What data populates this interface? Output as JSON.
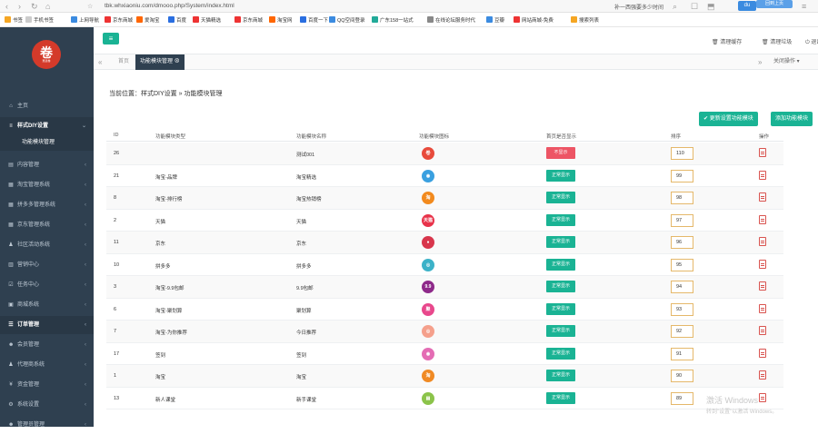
{
  "browser": {
    "url": "tbk.whxiaoniu.com/dmooo.php/System/index.html",
    "search": "补一西强要多少时间",
    "extra": "回到上页"
  },
  "bookmarks": [
    "书签",
    "手机书签",
    "上网导航",
    "京东商城",
    "爱淘宝",
    "百度",
    "天猫精选",
    "京东商城",
    "淘宝网",
    "百度一下",
    "QQ空间登录",
    "广东158一站式",
    "在线论坛服务时代",
    "豆瓣",
    "网站商城-免费",
    "搜索列表"
  ],
  "sidebar": {
    "logo": "卷",
    "logo_sub": "惠选卷",
    "items": [
      {
        "label": "主页"
      },
      {
        "label": "样式DIY设置"
      },
      {
        "label": "功能模块管理"
      },
      {
        "label": "内容管理"
      },
      {
        "label": "淘宝管理系统"
      },
      {
        "label": "拼多多管理系统"
      },
      {
        "label": "京东管理系统"
      },
      {
        "label": "社区活动系统"
      },
      {
        "label": "营销中心"
      },
      {
        "label": "任务中心"
      },
      {
        "label": "商城系统"
      },
      {
        "label": "订单管理"
      },
      {
        "label": "会员管理"
      },
      {
        "label": "代理商系统"
      },
      {
        "label": "资金管理"
      },
      {
        "label": "系统设置"
      },
      {
        "label": "管理员管理"
      }
    ]
  },
  "topbar": {
    "clear_cache": "清理缓存",
    "clear_log": "清理垃圾",
    "logout": "退出",
    "tabs_close": "关闭操作"
  },
  "tabs": {
    "home": "首页",
    "active": "功能模块管理"
  },
  "breadcrumb": "当前位置：样式DIY设置 » 功能模块管理",
  "buttons": {
    "update": "更新设置功能模块",
    "add": "添加功能模块"
  },
  "table": {
    "headers": [
      "ID",
      "功能模块类型",
      "功能模块名称",
      "功能模块图标",
      "首页是否显示",
      "排序",
      "操作"
    ],
    "rows": [
      {
        "id": "26",
        "type": "",
        "name": "测试001",
        "status": "不显示",
        "sort": "110",
        "icon_color": "#e84b3c",
        "icon_txt": "卷"
      },
      {
        "id": "21",
        "type": "淘宝-品牌",
        "name": "淘宝精选",
        "status": "正常显示",
        "sort": "99",
        "icon_color": "#3aa0e0",
        "icon_txt": "◉"
      },
      {
        "id": "8",
        "type": "淘宝-排行榜",
        "name": "淘宝热销榜",
        "status": "正常显示",
        "sort": "98",
        "icon_color": "#f28a1e",
        "icon_txt": "淘"
      },
      {
        "id": "2",
        "type": "天猫",
        "name": "天猫",
        "status": "正常显示",
        "sort": "97",
        "icon_color": "#e8334a",
        "icon_txt": "天猫"
      },
      {
        "id": "11",
        "type": "京东",
        "name": "京东",
        "status": "正常显示",
        "sort": "96",
        "icon_color": "#d8364c",
        "icon_txt": "●"
      },
      {
        "id": "10",
        "type": "拼多多",
        "name": "拼多多",
        "status": "正常显示",
        "sort": "95",
        "icon_color": "#3cb2c8",
        "icon_txt": "◎"
      },
      {
        "id": "3",
        "type": "淘宝-9.9包邮",
        "name": "9.9包邮",
        "status": "正常显示",
        "sort": "94",
        "icon_color": "#8e2a8a",
        "icon_txt": "9.9"
      },
      {
        "id": "6",
        "type": "淘宝-聚划算",
        "name": "聚划算",
        "status": "正常显示",
        "sort": "93",
        "icon_color": "#e8488c",
        "icon_txt": "聚"
      },
      {
        "id": "7",
        "type": "淘宝-为你推荐",
        "name": "今日推荐",
        "status": "正常显示",
        "sort": "92",
        "icon_color": "#f5a08c",
        "icon_txt": "◎"
      },
      {
        "id": "17",
        "type": "签到",
        "name": "签到",
        "status": "正常显示",
        "sort": "91",
        "icon_color": "#e46cb4",
        "icon_txt": "◉"
      },
      {
        "id": "1",
        "type": "淘宝",
        "name": "淘宝",
        "status": "正常显示",
        "sort": "90",
        "icon_color": "#f08a24",
        "icon_txt": "淘"
      },
      {
        "id": "13",
        "type": "新人课堂",
        "name": "新手课堂",
        "status": "正常显示",
        "sort": "89",
        "icon_color": "#8bc34a",
        "icon_txt": "▤"
      }
    ]
  },
  "watermark": {
    "line1": "激活 Windows",
    "line2": "转到\"设置\"以激活 Windows。"
  },
  "colors": {
    "sidebar": "#2f4050",
    "accent": "#1ab394",
    "hide": "#ed5565"
  }
}
